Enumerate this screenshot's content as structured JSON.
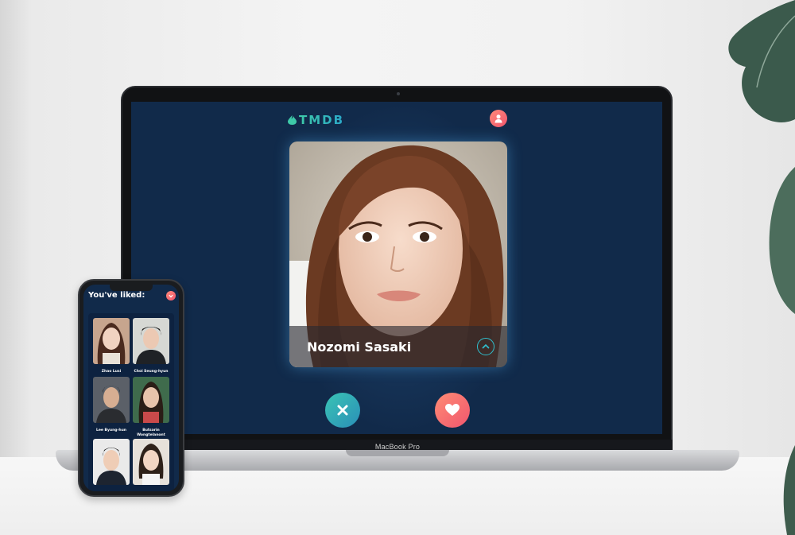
{
  "app": {
    "brand": "TMDB",
    "card": {
      "name": "Nozomi Sasaki"
    }
  },
  "device": {
    "laptop_label": "MacBook Pro"
  },
  "phone": {
    "title": "You've liked:",
    "liked": [
      {
        "name": "Zhao Lusi"
      },
      {
        "name": "Choi Seung-hyun"
      },
      {
        "name": "Lee Byung-hun"
      },
      {
        "name": "Butsarin Wongtelanont"
      },
      {
        "name": ""
      },
      {
        "name": ""
      }
    ]
  },
  "colors": {
    "screen_bg": "#112a4a",
    "brand_teal": "#3ec9a8",
    "like_coral": "#f0566e",
    "reject_teal": "#2a8fb8"
  },
  "icons": [
    "leaf-logo-icon",
    "user-icon",
    "chevron-up-icon",
    "close-x-icon",
    "heart-icon",
    "chevron-down-icon"
  ]
}
